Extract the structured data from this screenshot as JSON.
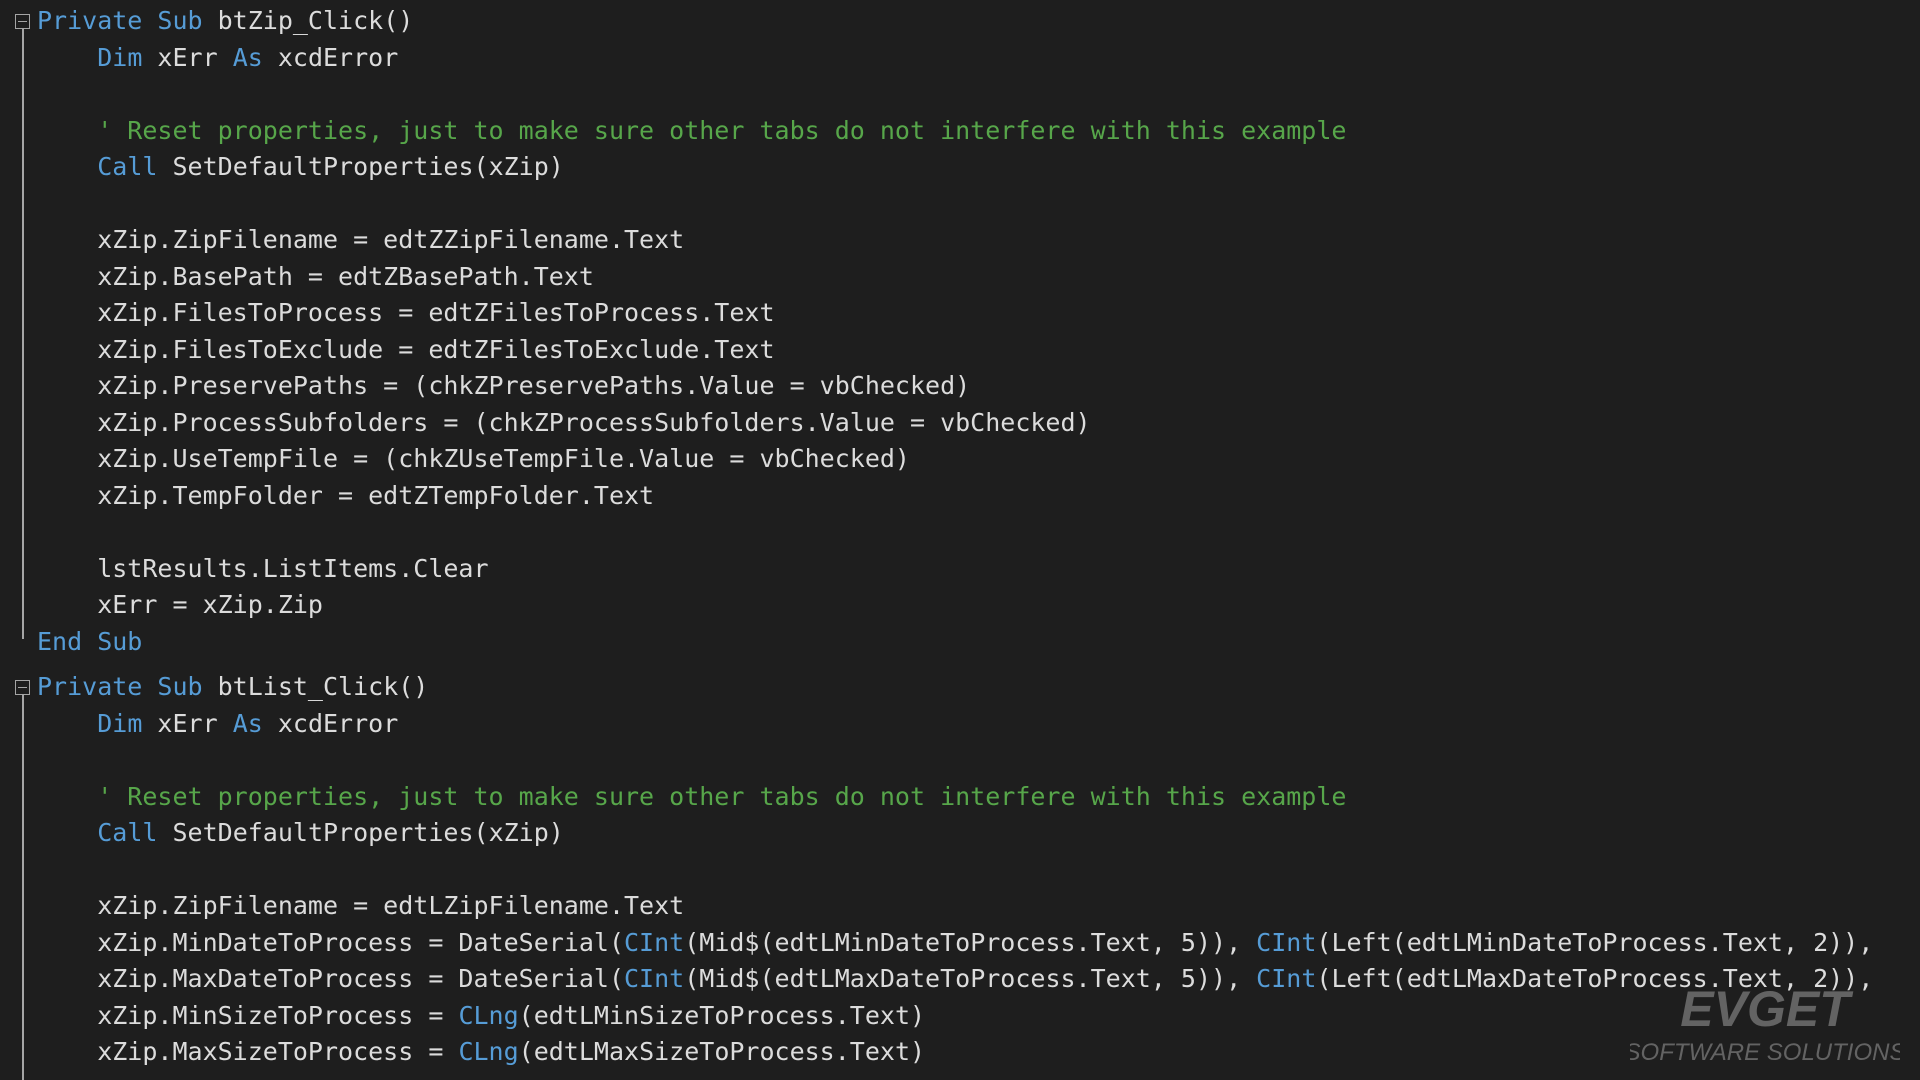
{
  "editor": {
    "colors": {
      "background": "#1e1e1e",
      "text": "#dcdcdc",
      "keyword": "#569cd6",
      "comment": "#57a64a",
      "fold_guide": "#a5a5a5"
    },
    "procedures": [
      {
        "lines": [
          {
            "tokens": [
              {
                "t": "Private Sub",
                "c": "kw"
              },
              {
                "t": " btZip_Click()",
                "c": ""
              }
            ]
          },
          {
            "tokens": [
              {
                "t": "    ",
                "c": ""
              },
              {
                "t": "Dim",
                "c": "kw"
              },
              {
                "t": " xErr ",
                "c": ""
              },
              {
                "t": "As",
                "c": "kw"
              },
              {
                "t": " xcdError",
                "c": ""
              }
            ]
          },
          {
            "tokens": []
          },
          {
            "tokens": [
              {
                "t": "    ' Reset properties, just to make sure other tabs do not interfere with this example",
                "c": "cmt"
              }
            ]
          },
          {
            "tokens": [
              {
                "t": "    ",
                "c": ""
              },
              {
                "t": "Call",
                "c": "kw"
              },
              {
                "t": " SetDefaultProperties(xZip)",
                "c": ""
              }
            ]
          },
          {
            "tokens": []
          },
          {
            "tokens": [
              {
                "t": "    xZip.ZipFilename = edtZZipFilename.Text",
                "c": ""
              }
            ]
          },
          {
            "tokens": [
              {
                "t": "    xZip.BasePath = edtZBasePath.Text",
                "c": ""
              }
            ]
          },
          {
            "tokens": [
              {
                "t": "    xZip.FilesToProcess = edtZFilesToProcess.Text",
                "c": ""
              }
            ]
          },
          {
            "tokens": [
              {
                "t": "    xZip.FilesToExclude = edtZFilesToExclude.Text",
                "c": ""
              }
            ]
          },
          {
            "tokens": [
              {
                "t": "    xZip.PreservePaths = (chkZPreservePaths.Value = vbChecked)",
                "c": ""
              }
            ]
          },
          {
            "tokens": [
              {
                "t": "    xZip.ProcessSubfolders = (chkZProcessSubfolders.Value = vbChecked)",
                "c": ""
              }
            ]
          },
          {
            "tokens": [
              {
                "t": "    xZip.UseTempFile = (chkZUseTempFile.Value = vbChecked)",
                "c": ""
              }
            ]
          },
          {
            "tokens": [
              {
                "t": "    xZip.TempFolder = edtZTempFolder.Text",
                "c": ""
              }
            ]
          },
          {
            "tokens": []
          },
          {
            "tokens": [
              {
                "t": "    lstResults.ListItems.Clear",
                "c": ""
              }
            ]
          },
          {
            "tokens": [
              {
                "t": "    xErr = xZip.Zip",
                "c": ""
              }
            ]
          },
          {
            "tokens": [
              {
                "t": "End Sub",
                "c": "kw"
              }
            ]
          }
        ]
      },
      {
        "lines": [
          {
            "tokens": [
              {
                "t": "Private Sub",
                "c": "kw"
              },
              {
                "t": " btList_Click()",
                "c": ""
              }
            ]
          },
          {
            "tokens": [
              {
                "t": "    ",
                "c": ""
              },
              {
                "t": "Dim",
                "c": "kw"
              },
              {
                "t": " xErr ",
                "c": ""
              },
              {
                "t": "As",
                "c": "kw"
              },
              {
                "t": " xcdError",
                "c": ""
              }
            ]
          },
          {
            "tokens": []
          },
          {
            "tokens": [
              {
                "t": "    ' Reset properties, just to make sure other tabs do not interfere with this example",
                "c": "cmt"
              }
            ]
          },
          {
            "tokens": [
              {
                "t": "    ",
                "c": ""
              },
              {
                "t": "Call",
                "c": "kw"
              },
              {
                "t": " SetDefaultProperties(xZip)",
                "c": ""
              }
            ]
          },
          {
            "tokens": []
          },
          {
            "tokens": [
              {
                "t": "    xZip.ZipFilename = edtLZipFilename.Text",
                "c": ""
              }
            ]
          },
          {
            "tokens": [
              {
                "t": "    xZip.MinDateToProcess = DateSerial(",
                "c": ""
              },
              {
                "t": "CInt",
                "c": "fn"
              },
              {
                "t": "(Mid$(edtLMinDateToProcess.Text, 5)), ",
                "c": ""
              },
              {
                "t": "CInt",
                "c": "fn"
              },
              {
                "t": "(Left(edtLMinDateToProcess.Text, 2)), ",
                "c": ""
              }
            ]
          },
          {
            "tokens": [
              {
                "t": "    xZip.MaxDateToProcess = DateSerial(",
                "c": ""
              },
              {
                "t": "CInt",
                "c": "fn"
              },
              {
                "t": "(Mid$(edtLMaxDateToProcess.Text, 5)), ",
                "c": ""
              },
              {
                "t": "CInt",
                "c": "fn"
              },
              {
                "t": "(Left(edtLMaxDateToProcess.Text, 2)), ",
                "c": ""
              }
            ]
          },
          {
            "tokens": [
              {
                "t": "    xZip.MinSizeToProcess = ",
                "c": ""
              },
              {
                "t": "CLng",
                "c": "fn"
              },
              {
                "t": "(edtLMinSizeToProcess.Text)",
                "c": ""
              }
            ]
          },
          {
            "tokens": [
              {
                "t": "    xZip.MaxSizeToProcess = ",
                "c": ""
              },
              {
                "t": "CLng",
                "c": "fn"
              },
              {
                "t": "(edtLMaxSizeToProcess.Text)",
                "c": ""
              }
            ]
          }
        ]
      }
    ]
  },
  "watermark": {
    "brand": "EVGET",
    "tagline": "SOFTWARE SOLUTIONS"
  }
}
